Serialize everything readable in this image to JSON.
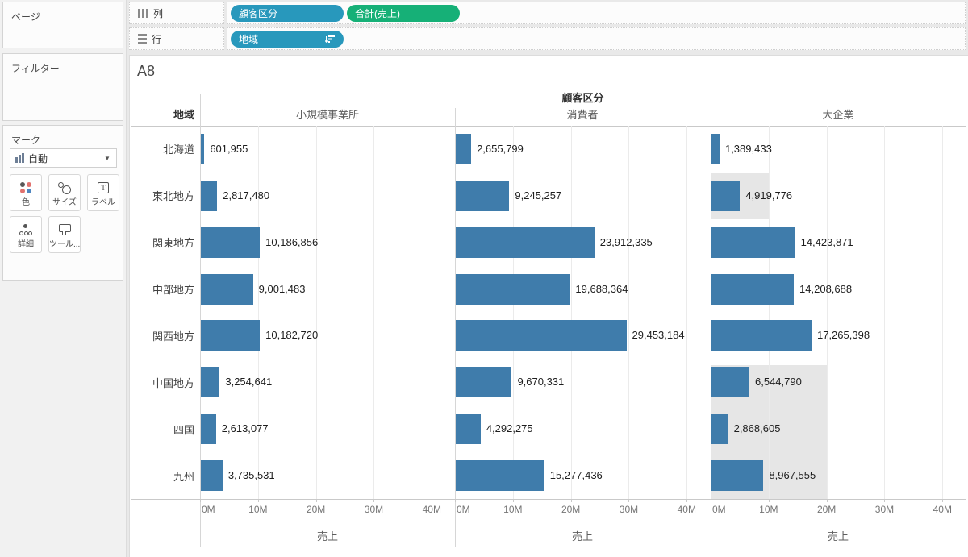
{
  "sidebar": {
    "pages_label": "ページ",
    "filters_label": "フィルター",
    "marks": {
      "label": "マーク",
      "mark_type": "自動",
      "dropdown_icon": "bar-chart-icon",
      "buttons": [
        {
          "label": "色",
          "icon": "color-icon"
        },
        {
          "label": "サイズ",
          "icon": "size-icon"
        },
        {
          "label": "ラベル",
          "icon": "label-icon"
        },
        {
          "label": "詳細",
          "icon": "detail-icon"
        },
        {
          "label": "ツール...",
          "icon": "tooltip-icon"
        }
      ]
    }
  },
  "shelves": {
    "columns": {
      "label": "列",
      "icon": "columns-icon",
      "pills": [
        {
          "label": "顧客区分",
          "color": "#2898bc",
          "type": "dimension"
        },
        {
          "label": "合計(売上)",
          "color": "#16b077",
          "type": "measure"
        }
      ]
    },
    "rows": {
      "label": "行",
      "icon": "rows-icon",
      "pills": [
        {
          "label": "地域",
          "color": "#2898bc",
          "type": "dimension",
          "sorted_desc": true,
          "icon": "sort-descending-icon"
        }
      ]
    }
  },
  "sheet": {
    "title": "A8"
  },
  "chart_data": {
    "type": "bar",
    "orientation": "horizontal",
    "col_field": "顧客区分",
    "row_field": "地域",
    "categories": [
      "北海道",
      "東北地方",
      "関東地方",
      "中部地方",
      "関西地方",
      "中国地方",
      "四国",
      "九州"
    ],
    "series": [
      {
        "name": "小規模事業所",
        "values": [
          601955,
          2817480,
          10186856,
          9001483,
          10182720,
          3254641,
          2613077,
          3735531
        ]
      },
      {
        "name": "消費者",
        "values": [
          2655799,
          9245257,
          23912335,
          19688364,
          29453184,
          9670331,
          4292275,
          15277436
        ]
      },
      {
        "name": "大企業",
        "values": [
          1389433,
          4919776,
          14423871,
          14208688,
          17265398,
          6544790,
          2868605,
          8967555
        ]
      }
    ],
    "xlabel": "売上",
    "axis_ticks": [
      "0M",
      "10M",
      "20M",
      "30M",
      "40M"
    ],
    "tick_values": [
      0,
      10000000,
      20000000,
      30000000,
      40000000
    ],
    "axis_max": 44000000,
    "grid": true,
    "bar_color": "#3f7cab",
    "label_position": "outside-end",
    "highlight_color": "#e6e6e6",
    "highlights": [
      {
        "pane": 2,
        "start_row": 1,
        "end_row": 1,
        "extent": 10000000,
        "inset_top": 0
      },
      {
        "pane": 2,
        "start_row": 5,
        "end_row": 7,
        "extent": 20000000,
        "inset_top": 8
      }
    ]
  }
}
